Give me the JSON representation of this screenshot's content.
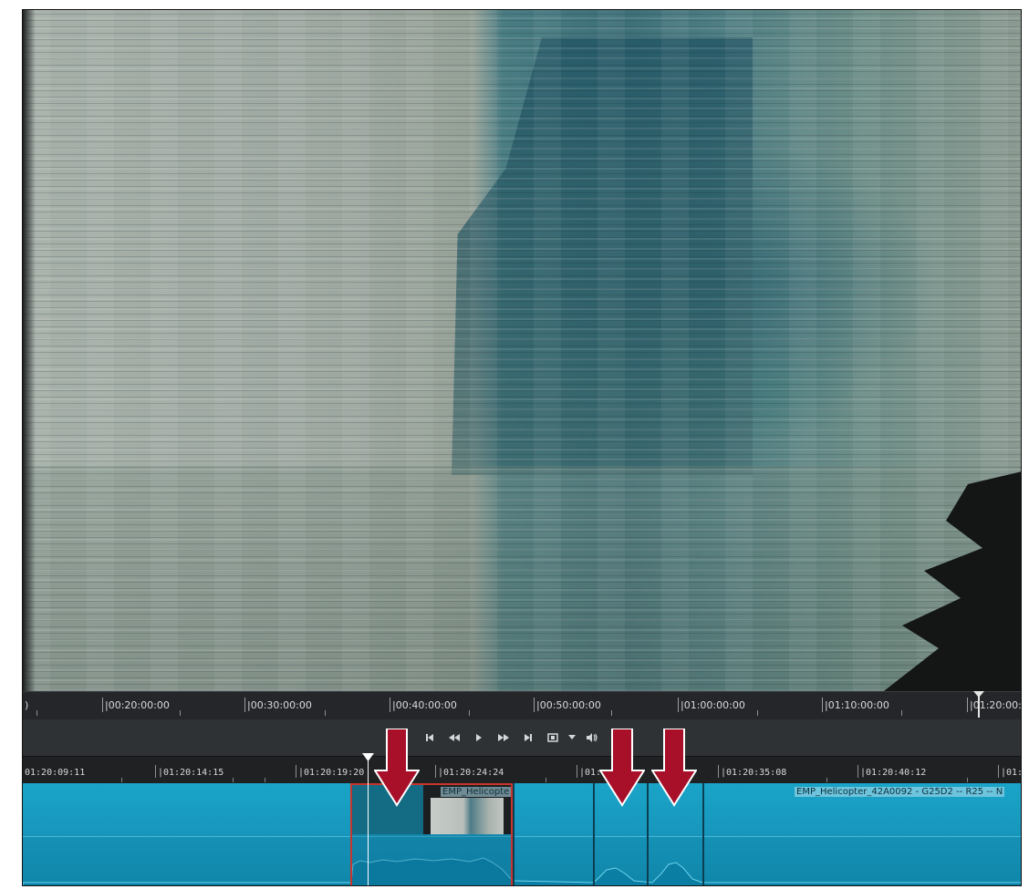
{
  "ruler_top": {
    "labels": [
      ")",
      "|00:20:00:00",
      "|00:30:00:00",
      "|00:40:00:00",
      "|00:50:00:00",
      "|01:00:00:00",
      "|01:10:00:00",
      "|01:20:00:"
    ]
  },
  "transport": {
    "buttons": [
      "go-to-start",
      "rewind",
      "play",
      "fast-forward",
      "go-to-end",
      "loop",
      "dropdown",
      "volume"
    ]
  },
  "ruler_timeline": {
    "labels": [
      "01:20:09:11",
      "|01:20:14:15",
      "|01:20:19:20",
      "|01:20:24:24",
      "|01:",
      "|01:20:35:08",
      "|01:20:40:12",
      "|01:"
    ]
  },
  "clips": {
    "short_label": "EMP_Helicopte",
    "long_label": "EMP_Helicopter_42A0092 - G25D2 -- R25 -- N"
  },
  "colors": {
    "track": "#1592b6",
    "selection": "#c7352d",
    "arrow": "#a8102a"
  }
}
